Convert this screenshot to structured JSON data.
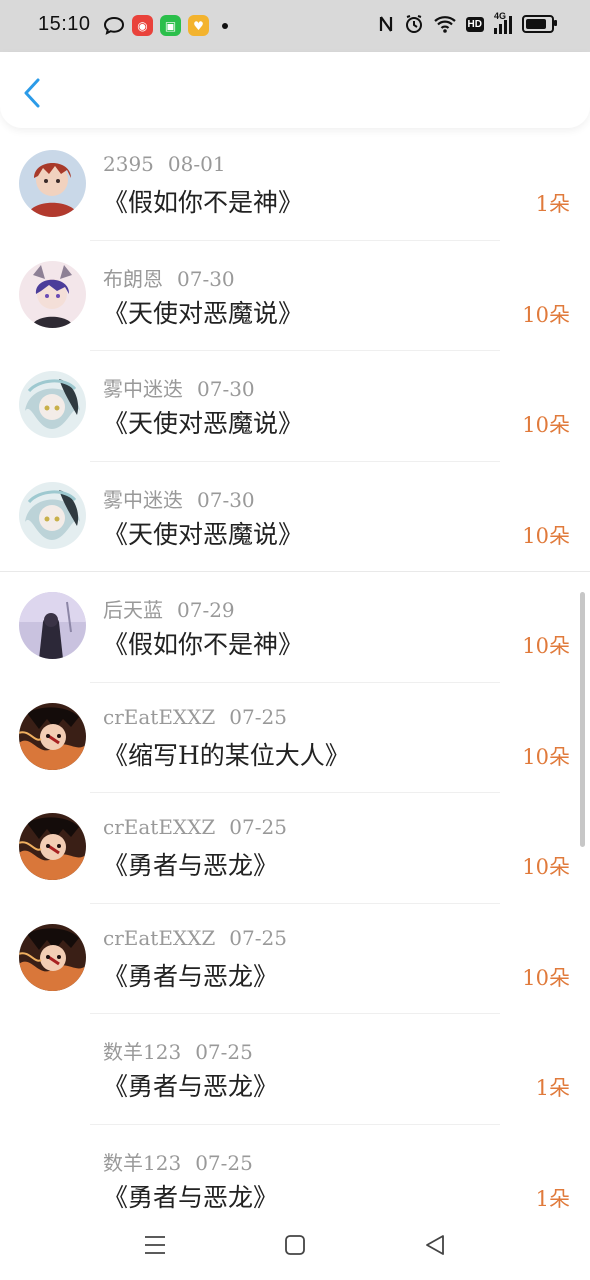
{
  "status_bar": {
    "time": "15:10",
    "network": "4G",
    "hd": "HD",
    "app_icon_colors": [
      "#e9423b",
      "#2bbf4b",
      "#f3b32e"
    ]
  },
  "nav": {
    "back_icon": "chevron-left-icon",
    "back_color": "#2b9be8"
  },
  "rows": [
    {
      "user": "2395",
      "date": "08-01",
      "title": "《假如你不是神》",
      "amount": "1朵",
      "avatar": "art-red"
    },
    {
      "user": "布朗恩",
      "date": "07-30",
      "title": "《天使对恶魔说》",
      "amount": "10朵",
      "avatar": "art-purple"
    },
    {
      "user": "雾中迷迭",
      "date": "07-30",
      "title": "《天使对恶魔说》",
      "amount": "10朵",
      "avatar": "art-teal"
    },
    {
      "user": "雾中迷迭",
      "date": "07-30",
      "title": "《天使对恶魔说》",
      "amount": "10朵",
      "avatar": "art-teal"
    },
    {
      "user": "后天蓝",
      "date": "07-29",
      "title": "《假如你不是神》",
      "amount": "10朵",
      "avatar": "art-lavender"
    },
    {
      "user": "crEatEXXZ",
      "date": "07-25",
      "title": "《缩写H的某位大人》",
      "amount": "10朵",
      "avatar": "art-fire"
    },
    {
      "user": "crEatEXXZ",
      "date": "07-25",
      "title": "《勇者与恶龙》",
      "amount": "10朵",
      "avatar": "art-fire"
    },
    {
      "user": "crEatEXXZ",
      "date": "07-25",
      "title": "《勇者与恶龙》",
      "amount": "10朵",
      "avatar": "art-fire"
    },
    {
      "user": "数羊123",
      "date": "07-25",
      "title": "《勇者与恶龙》",
      "amount": "1朵",
      "avatar": "none"
    },
    {
      "user": "数羊123",
      "date": "07-25",
      "title": "《勇者与恶龙》",
      "amount": "1朵",
      "avatar": "none"
    }
  ],
  "colors": {
    "amount": "#e07a3b",
    "meta": "#999999",
    "title": "#222222"
  },
  "bottom_nav": [
    "menu-icon",
    "home-square-icon",
    "back-triangle-icon"
  ]
}
